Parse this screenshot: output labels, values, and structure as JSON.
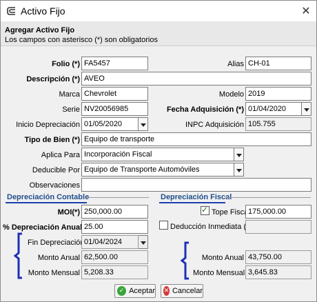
{
  "window": {
    "title": "Activo Fijo",
    "close_glyph": "✕"
  },
  "header": {
    "title": "Agregar Activo Fijo",
    "subtitle": "Los campos con asterisco (*) son obligatorios"
  },
  "form": {
    "folio": {
      "label": "Folio (*)",
      "value": "FA5457"
    },
    "alias": {
      "label": "Alias",
      "value": "CH-01"
    },
    "descripcion": {
      "label": "Descripción (*)",
      "value": "AVEO"
    },
    "marca": {
      "label": "Marca",
      "value": "Chevrolet"
    },
    "modelo": {
      "label": "Modelo",
      "value": "2019"
    },
    "serie": {
      "label": "Serie",
      "value": "NV20056985"
    },
    "fecha_adquisicion": {
      "label": "Fecha Adquisición (*)",
      "value": "01/04/2020"
    },
    "inicio_depreciacion": {
      "label": "Inicio Depreciación",
      "value": "01/05/2020"
    },
    "inpc_adquisicion": {
      "label": "INPC Adquisición",
      "value": "105.755"
    },
    "tipo_bien": {
      "label": "Tipo de Bien (*)",
      "value": "Equipo de transporte"
    },
    "aplica_para": {
      "label": "Aplica Para",
      "value": "Incorporación Fiscal"
    },
    "deducible_por": {
      "label": "Deducible Por",
      "value": "Equipo de Transporte Automóviles"
    },
    "observaciones": {
      "label": "Observaciones",
      "value": ""
    }
  },
  "contable": {
    "title": "Depreciación Contable",
    "moi": {
      "label": "MOI(*)",
      "value": "250,000.00"
    },
    "pct": {
      "label": "% Depreciación Anual (*)",
      "value": "25.00"
    },
    "fin": {
      "label": "Fin Depreciación",
      "value": "01/04/2024"
    },
    "monto_anual": {
      "label": "Monto Anual",
      "value": "62,500.00"
    },
    "monto_mensual": {
      "label": "Monto Mensual",
      "value": "5,208.33"
    }
  },
  "fiscal": {
    "title": "Depreciación Fiscal",
    "tope": {
      "label": "Tope Fiscal",
      "value": "175,000.00",
      "checked": true
    },
    "deduccion": {
      "label": "Deducción Inmediata (%)",
      "value": "",
      "checked": false
    },
    "monto_anual": {
      "label": "Monto Anual",
      "value": "43,750.00"
    },
    "monto_mensual": {
      "label": "Monto Mensual",
      "value": "3,645.83"
    }
  },
  "buttons": {
    "accept": "Aceptar",
    "cancel": "Cancelar"
  },
  "colors": {
    "section_title": "#1f4e8c",
    "underline": "#1b3fae",
    "brace": "#1b2fb8",
    "accept_icon": "#3aa53a",
    "cancel_icon": "#d43a3a"
  }
}
